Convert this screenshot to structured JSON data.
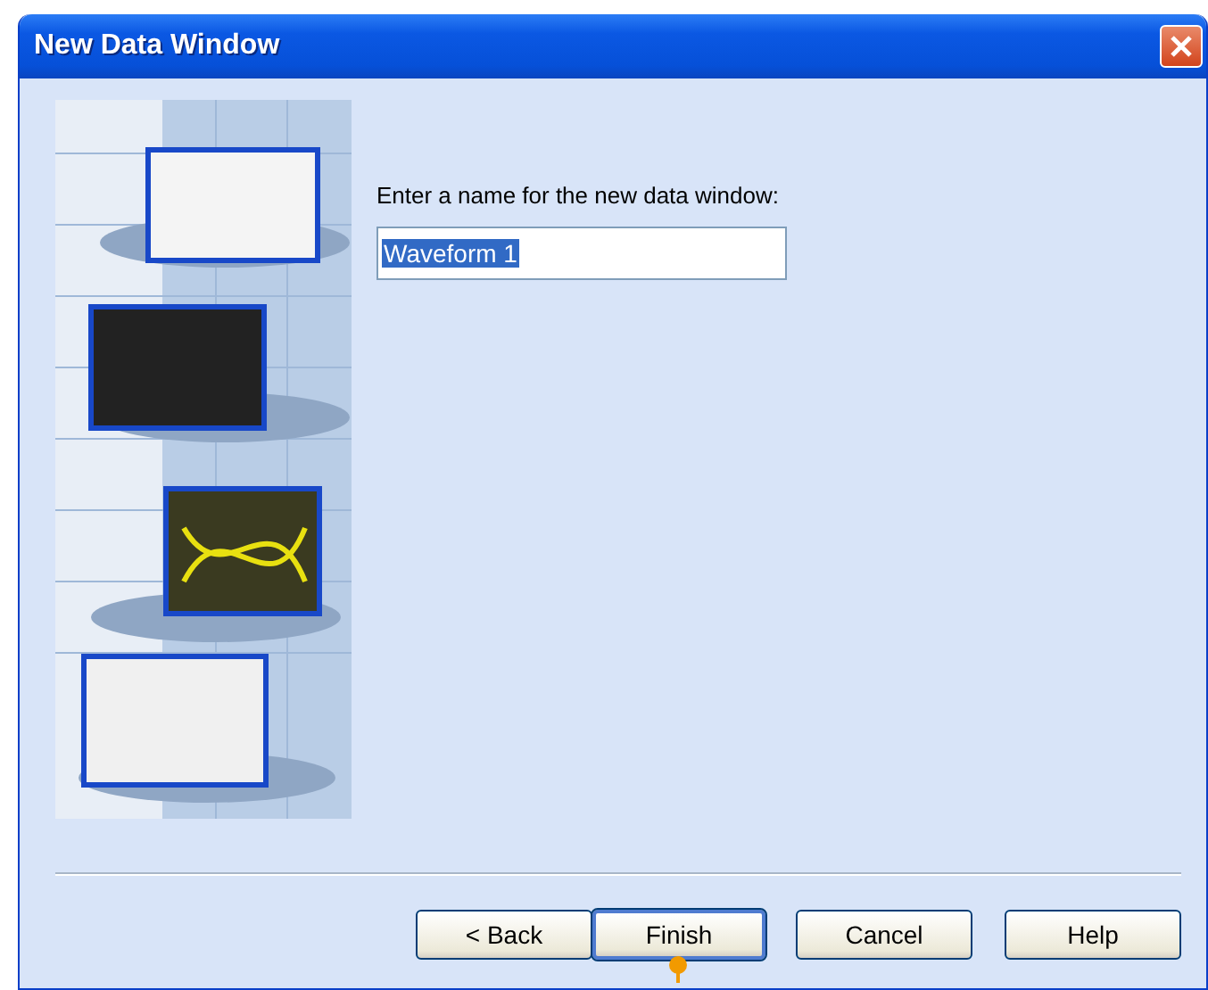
{
  "window": {
    "title": "New Data Window"
  },
  "prompt": "Enter a name for the new data window:",
  "name_field": {
    "value": "Waveform 1",
    "text_selected": true
  },
  "buttons": [
    {
      "label": "< Back",
      "default": false
    },
    {
      "label": "Finish",
      "default": true
    },
    {
      "label": "Cancel",
      "default": false
    },
    {
      "label": "Help",
      "default": false
    }
  ]
}
